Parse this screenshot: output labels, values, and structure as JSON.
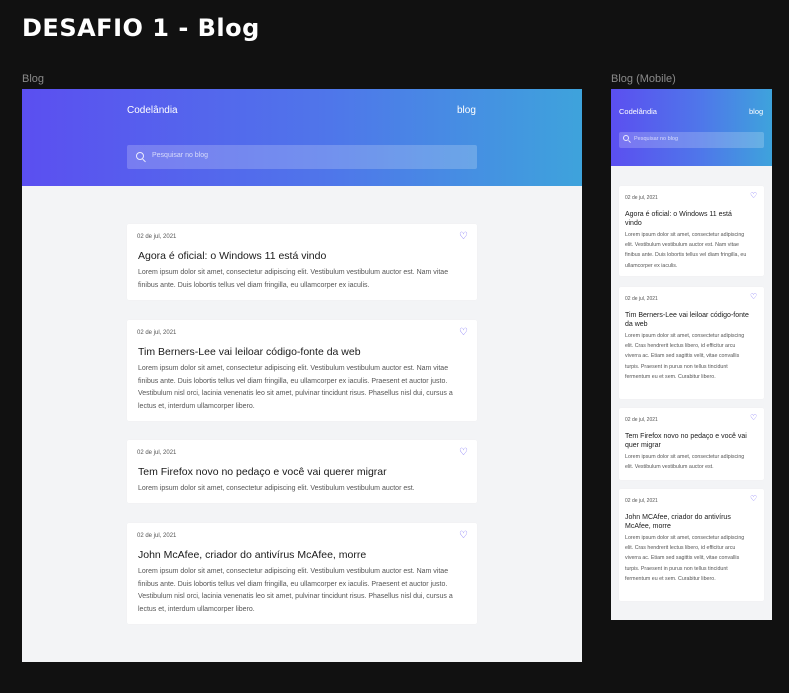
{
  "page_title": "DESAFIO 1 - Blog",
  "frames": {
    "desktop_label": "Blog",
    "mobile_label": "Blog (Mobile)"
  },
  "header": {
    "logo": "Codelândia",
    "nav_link": "blog",
    "search_placeholder": "Pesquisar no blog"
  },
  "colors": {
    "gradient_start": "#5b4ff0",
    "gradient_end": "#3ea3dc",
    "heart": "#6b5cf5",
    "background": "#f3f4f6"
  },
  "icons": {
    "search": "search-icon",
    "favorite": "heart-icon"
  },
  "desktop_posts": [
    {
      "date": "02 de jul, 2021",
      "title": "Agora é oficial: o Windows 11 está vindo",
      "excerpt": "Lorem ipsum dolor sit amet, consectetur adipiscing elit. Vestibulum vestibulum auctor est. Nam vitae finibus ante. Duis lobortis tellus vel diam fringilla, eu ullamcorper ex iaculis."
    },
    {
      "date": "02 de jul, 2021",
      "title": "Tim Berners-Lee vai leiloar código-fonte da web",
      "excerpt": "Lorem ipsum dolor sit amet, consectetur adipiscing elit. Vestibulum vestibulum auctor est. Nam vitae finibus ante. Duis lobortis tellus vel diam fringilla, eu ullamcorper ex iaculis. Praesent et auctor justo. Vestibulum nisl orci, lacinia venenatis leo sit amet, pulvinar tincidunt risus. Phasellus nisl dui, cursus a lectus et, interdum ullamcorper libero."
    },
    {
      "date": "02 de jul, 2021",
      "title": "Tem Firefox novo no pedaço e você vai querer migrar",
      "excerpt": "Lorem ipsum dolor sit amet, consectetur adipiscing elit. Vestibulum vestibulum auctor est."
    },
    {
      "date": "02 de jul, 2021",
      "title": "John McAfee, criador do antivírus McAfee, morre",
      "excerpt": "Lorem ipsum dolor sit amet, consectetur adipiscing elit. Vestibulum vestibulum auctor est. Nam vitae finibus ante. Duis lobortis tellus vel diam fringilla, eu ullamcorper ex iaculis. Praesent et auctor justo. Vestibulum nisl orci, lacinia venenatis leo sit amet, pulvinar tincidunt risus. Phasellus nisl dui, cursus a lectus et, interdum ullamcorper libero."
    }
  ],
  "mobile_posts": [
    {
      "date": "02 de jul, 2021",
      "title": "Agora é oficial: o Windows 11 está vindo",
      "excerpt": "Lorem ipsum dolor sit amet, consectetur adipiscing elit. Vestibulum vestibulum auctor est. Nam vitae finibus ante. Duis lobortis tellus vel diam fringilla, eu ullamcorper ex iaculis."
    },
    {
      "date": "02 de jul, 2021",
      "title": "Tim Berners-Lee vai leiloar código-fonte da web",
      "excerpt": "Lorem ipsum dolor sit amet, consectetur adipiscing elit. Cras hendrerit lectus libero, id efficitur arcu viverra ac. Etiam sed sagittis velit, vitae convallis turpis. Praesent in purus non tellus tincidunt fermentum eu et sem. Curabitur libero."
    },
    {
      "date": "02 de jul, 2021",
      "title": "Tem Firefox novo no pedaço e você vai quer migrar",
      "excerpt": "Lorem ipsum dolor sit amet, consectetur adipiscing elit. Vestibulum vestibulum auctor est."
    },
    {
      "date": "02 de jul, 2021",
      "title": "John MCAfee, criador do antivírus McAfee, morre",
      "excerpt": "Lorem ipsum dolor sit amet, consectetur adipiscing elit. Cras hendrerit lectus libero, id efficitur arcu viverra ac. Etiam sed sagittis velit, vitae convallis turpis. Praesent in purus non tellus tincidunt fermentum eu et sem. Curabitur libero."
    }
  ]
}
